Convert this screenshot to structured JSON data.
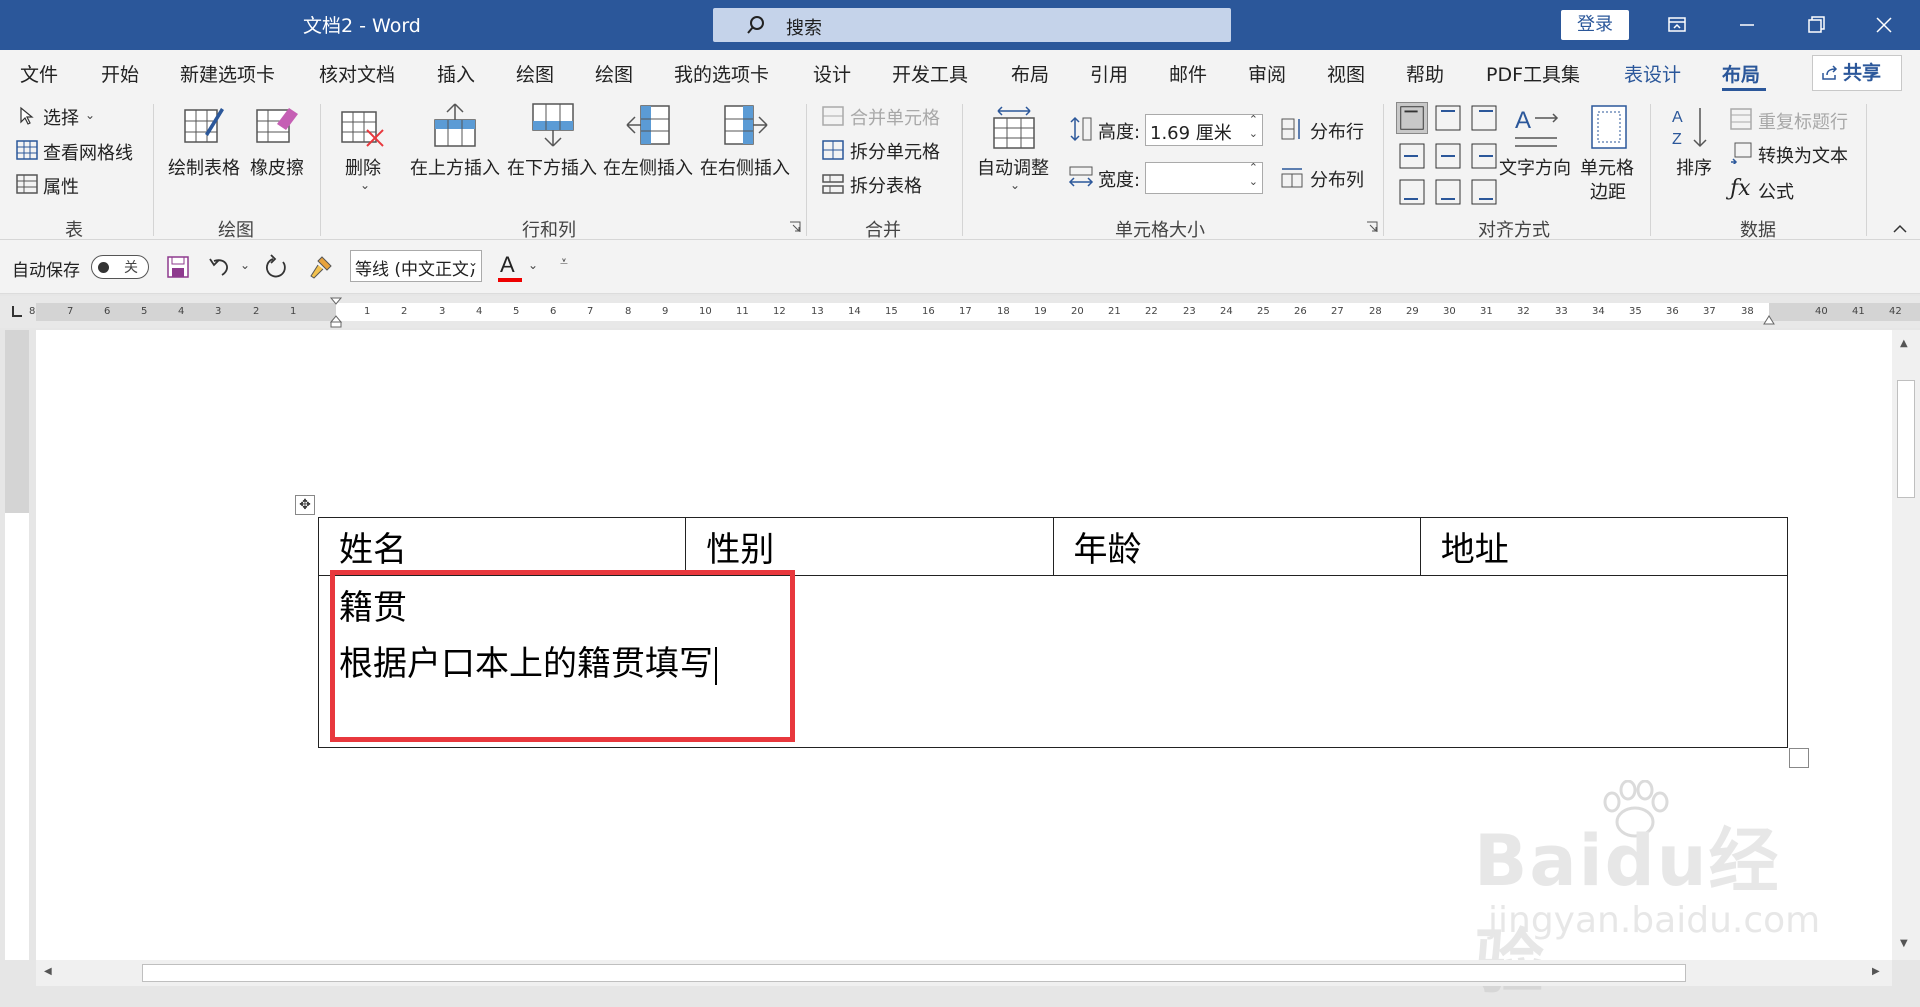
{
  "titlebar": {
    "doc_title": "文档2 - Word",
    "search_placeholder": "搜索",
    "login_label": "登录"
  },
  "tabs": [
    "文件",
    "开始",
    "新建选项卡",
    "核对文档",
    "插入",
    "绘图",
    "绘图",
    "我的选项卡",
    "设计",
    "开发工具",
    "布局",
    "引用",
    "邮件",
    "审阅",
    "视图",
    "帮助",
    "PDF工具集",
    "表设计",
    "布局"
  ],
  "active_tab": "布局",
  "share_label": "共享",
  "ribbon": {
    "table_group": {
      "select": "选择",
      "view_gridlines": "查看网格线",
      "properties": "属性",
      "label": "表"
    },
    "draw_group": {
      "draw_table": "绘制表格",
      "eraser": "橡皮擦",
      "label": "绘图"
    },
    "rows_cols_group": {
      "delete": "删除",
      "insert_above": "在上方插入",
      "insert_below": "在下方插入",
      "insert_left": "在左侧插入",
      "insert_right": "在右侧插入",
      "label": "行和列"
    },
    "merge_group": {
      "merge_cells": "合并单元格",
      "split_cells": "拆分单元格",
      "split_table": "拆分表格",
      "label": "合并"
    },
    "cell_size_group": {
      "autofit": "自动调整",
      "height_label": "高度:",
      "height_value": "1.69 厘米",
      "width_label": "宽度:",
      "width_value": "",
      "distribute_rows": "分布行",
      "distribute_cols": "分布列",
      "label": "单元格大小"
    },
    "alignment_group": {
      "text_direction": "文字方向",
      "cell_margins_line1": "单元格",
      "cell_margins_line2": "边距",
      "label": "对齐方式"
    },
    "data_group": {
      "sort": "排序",
      "repeat_header": "重复标题行",
      "convert_to_text": "转换为文本",
      "formula": "公式",
      "label": "数据"
    }
  },
  "qat": {
    "autosave_label": "自动保存",
    "autosave_state": "关",
    "font_name": "等线 (中文正文)"
  },
  "ruler_ticks": [
    "8",
    "7",
    "6",
    "5",
    "4",
    "3",
    "2",
    "1",
    "1",
    "2",
    "3",
    "4",
    "5",
    "6",
    "7",
    "8",
    "9",
    "10",
    "11",
    "12",
    "13",
    "14",
    "15",
    "16",
    "17",
    "18",
    "19",
    "20",
    "21",
    "22",
    "23",
    "24",
    "25",
    "26",
    "27",
    "28",
    "29",
    "30",
    "31",
    "32",
    "33",
    "34",
    "35",
    "36",
    "37",
    "38",
    "40",
    "41",
    "42"
  ],
  "document": {
    "headers": [
      "姓名",
      "性别",
      "年龄",
      "地址"
    ],
    "cell_line1": "籍贯",
    "cell_line2": "根据户口本上的籍贯填写"
  },
  "watermark": {
    "brand": "Baidu经验",
    "url": "jingyan.baidu.com"
  },
  "colors": {
    "titlebar": "#2b579a",
    "highlight": "#e8383d"
  }
}
